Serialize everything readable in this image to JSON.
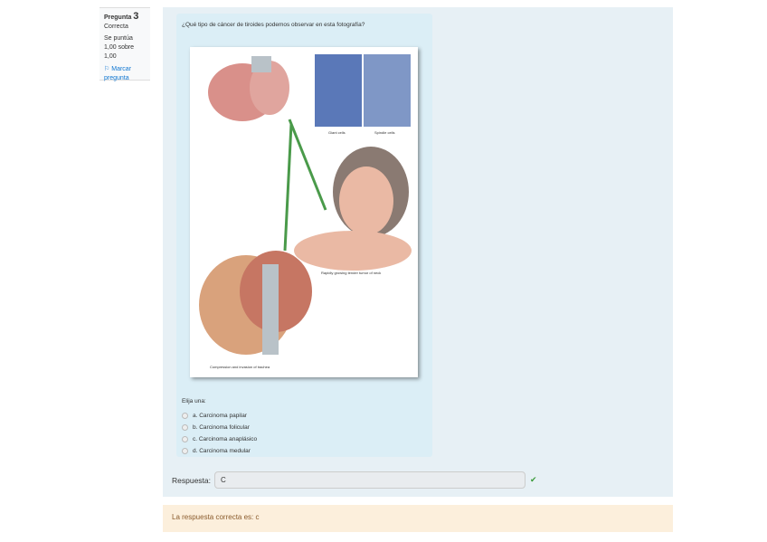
{
  "info": {
    "question_label": "Pregunta",
    "question_number": "3",
    "state": "Correcta",
    "grade": "Se puntúa 1,00 sobre 1,00",
    "flag_label": "Marcar pregunta"
  },
  "question": {
    "text": "¿Qué tipo de cáncer de tiroides podemos observar en esta fotografía?",
    "figure_captions": {
      "left_cells": "Giant cells",
      "right_cells": "Spindle cells",
      "neck": "Rapidly growing tender tumor of neck",
      "trachea": "Compression and invasion of trachea"
    },
    "prompt": "Elija una:",
    "options": [
      "a. Carcinoma papilar",
      "b. Carcinoma folicular",
      "c. Carcinoma anaplásico",
      "d. Carcinoma medular"
    ]
  },
  "response": {
    "label": "Respuesta:",
    "value": "C"
  },
  "feedback": {
    "text": "La respuesta correcta es: c"
  }
}
